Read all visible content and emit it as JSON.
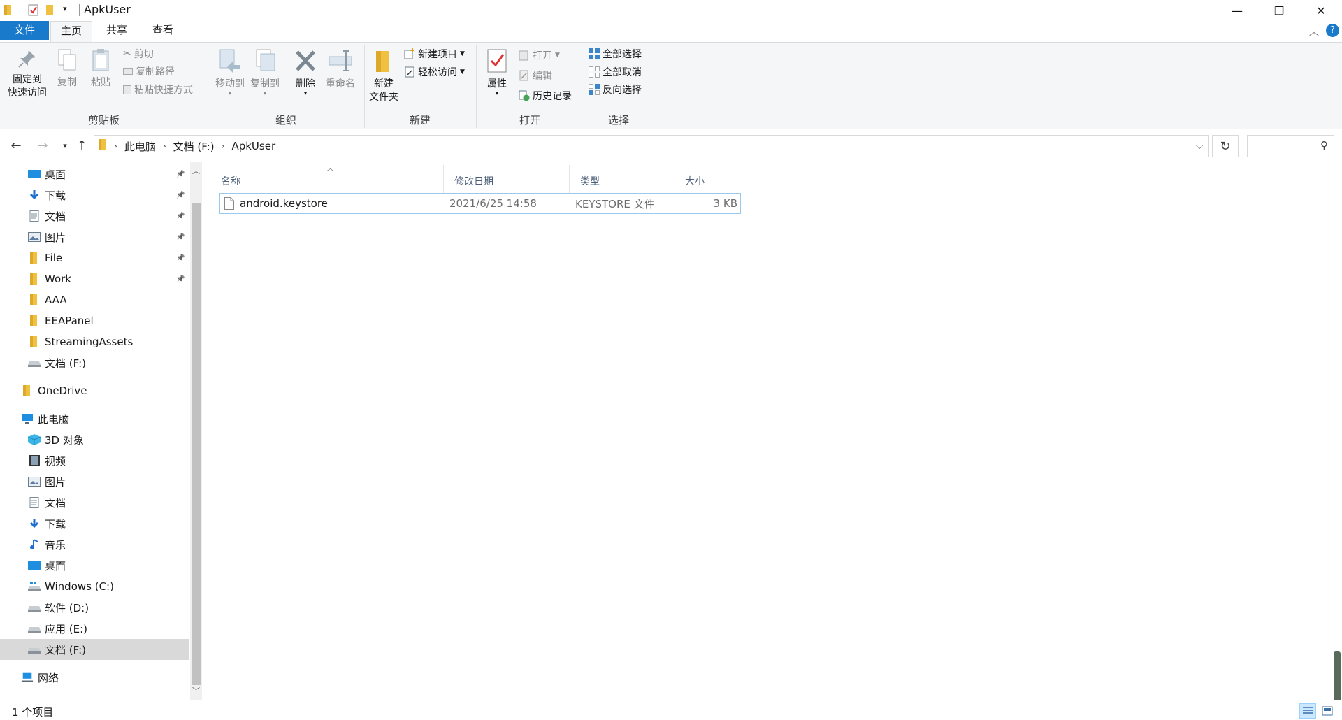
{
  "window": {
    "title": "ApkUser",
    "controls": {
      "minimize": "—",
      "maximize": "❐",
      "close": "✕"
    }
  },
  "ribbon_tabs": [
    "文件",
    "主页",
    "共享",
    "查看"
  ],
  "ribbon": {
    "clipboard": {
      "label": "剪贴板",
      "pin_quick_access": [
        "固定到",
        "快速访问"
      ],
      "copy": "复制",
      "paste": "粘贴",
      "cut": "剪切",
      "copy_path": "复制路径",
      "paste_shortcut": "粘贴快捷方式"
    },
    "organize": {
      "label": "组织",
      "move_to": "移动到",
      "copy_to": "复制到",
      "delete": "删除",
      "rename": "重命名"
    },
    "new": {
      "label": "新建",
      "new_folder": [
        "新建",
        "文件夹"
      ],
      "new_item": "新建项目",
      "easy_access": "轻松访问"
    },
    "open": {
      "label": "打开",
      "properties": "属性",
      "open": "打开",
      "edit": "编辑",
      "history": "历史记录"
    },
    "select": {
      "label": "选择",
      "select_all": "全部选择",
      "select_none": "全部取消",
      "invert": "反向选择"
    }
  },
  "breadcrumb": [
    "此电脑",
    "文档 (F:)",
    "ApkUser"
  ],
  "nav_pane": {
    "quick_access": [
      {
        "label": "桌面",
        "icon": "desktop-icon",
        "pinned": true
      },
      {
        "label": "下载",
        "icon": "download-icon",
        "pinned": true
      },
      {
        "label": "文档",
        "icon": "document-icon",
        "pinned": true
      },
      {
        "label": "图片",
        "icon": "picture-icon",
        "pinned": true
      },
      {
        "label": "File",
        "icon": "folder-icon",
        "pinned": true
      },
      {
        "label": "Work",
        "icon": "folder-icon",
        "pinned": true
      },
      {
        "label": "AAA",
        "icon": "folder-icon",
        "pinned": false
      },
      {
        "label": "EEAPanel",
        "icon": "folder-icon",
        "pinned": false
      },
      {
        "label": "StreamingAssets",
        "icon": "folder-icon",
        "pinned": false
      },
      {
        "label": "文档 (F:)",
        "icon": "drive-icon",
        "pinned": false
      }
    ],
    "onedrive": "OneDrive",
    "this_pc": "此电脑",
    "this_pc_items": [
      {
        "label": "3D 对象",
        "icon": "3d-objects-icon"
      },
      {
        "label": "视频",
        "icon": "video-icon"
      },
      {
        "label": "图片",
        "icon": "picture-icon"
      },
      {
        "label": "文档",
        "icon": "document-icon"
      },
      {
        "label": "下载",
        "icon": "download-icon"
      },
      {
        "label": "音乐",
        "icon": "music-icon"
      },
      {
        "label": "桌面",
        "icon": "desktop-icon"
      },
      {
        "label": "Windows (C:)",
        "icon": "windows-drive-icon"
      },
      {
        "label": "软件 (D:)",
        "icon": "drive-icon"
      },
      {
        "label": "应用 (E:)",
        "icon": "drive-icon"
      },
      {
        "label": "文档 (F:)",
        "icon": "drive-icon"
      }
    ],
    "network": "网络"
  },
  "columns": [
    "名称",
    "修改日期",
    "类型",
    "大小"
  ],
  "files": [
    {
      "name": "android.keystore",
      "modified": "2021/6/25 14:58",
      "type": "KEYSTORE 文件",
      "size": "3 KB"
    }
  ],
  "status": "1 个项目",
  "colors": {
    "file_tab": "#1979ca",
    "ribbon_bg": "#f5f6f7",
    "selection": "#cce8ff"
  }
}
